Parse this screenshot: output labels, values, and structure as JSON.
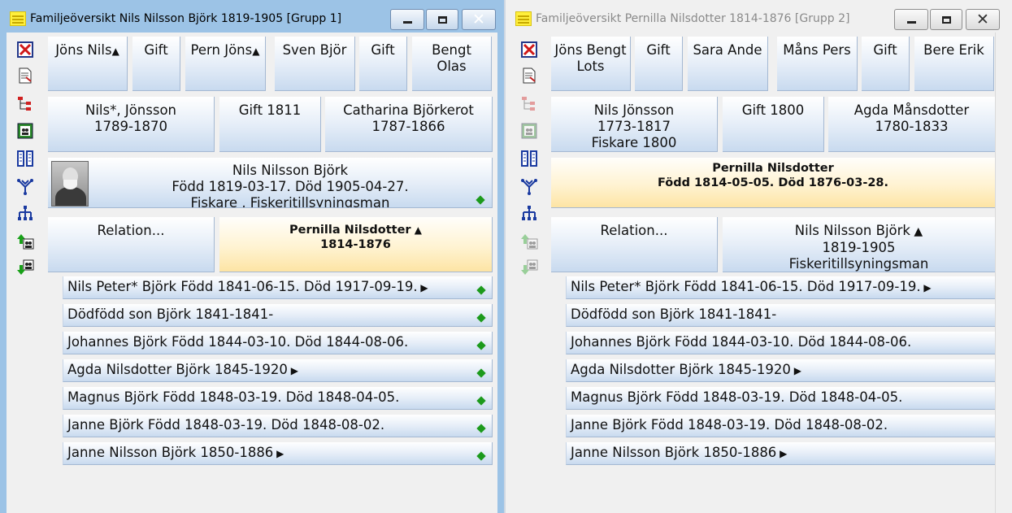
{
  "w1": {
    "title": "Familjeöversikt Nils Nilsson Björk 1819-1905 [Grupp 1]",
    "row1": [
      "Jöns Nils",
      "Gift",
      "Pern Jöns",
      "Sven Björ",
      "Gift",
      "Bengt Olas"
    ],
    "father": [
      "Nils*, Jönsson",
      "1789-1870"
    ],
    "parents_marriage": [
      "Gift 1811"
    ],
    "mother": [
      "Catharina Björkerot",
      "1787-1866"
    ],
    "main": [
      "Nils Nilsson Björk",
      "Född 1819-03-17. Död 1905-04-27.",
      "Fiskare , Fiskeritillsyningsman"
    ],
    "relation": [
      "Relation..."
    ],
    "spouse": [
      "Pernilla Nilsdotter",
      "1814-1876"
    ],
    "children": [
      "Nils Peter* Björk Född 1841-06-15. Död 1917-09-19.",
      "Dödfödd son Björk 1841-1841-",
      "Johannes Björk Född 1844-03-10. Död 1844-08-06.",
      "Agda Nilsdotter Björk 1845-1920",
      "Magnus Björk Född 1848-03-19. Död 1848-04-05.",
      "Janne Björk Född 1848-03-19. Död 1848-08-02.",
      "Janne Nilsson Björk 1850-1886"
    ]
  },
  "w2": {
    "title": "Familjeöversikt Pernilla Nilsdotter 1814-1876 [Grupp 2]",
    "row1": [
      "Jöns Bengt Lots",
      "Gift",
      "Sara Ande",
      "Måns Pers",
      "Gift",
      "Bere Erik"
    ],
    "father": [
      "Nils Jönsson",
      "1773-1817",
      "Fiskare  1800"
    ],
    "parents_marriage": [
      "Gift 1800"
    ],
    "mother": [
      "Agda Månsdotter",
      "1780-1833"
    ],
    "main": [
      "Pernilla Nilsdotter",
      "Född 1814-05-05. Död 1876-03-28."
    ],
    "relation": [
      "Relation..."
    ],
    "spouse": [
      "Nils Nilsson Björk",
      "1819-1905",
      "Fiskeritillsyningsman"
    ],
    "children": [
      "Nils Peter* Björk Född 1841-06-15. Död 1917-09-19.",
      "Dödfödd son Björk 1841-1841-",
      "Johannes Björk Född 1844-03-10. Död 1844-08-06.",
      "Agda Nilsdotter Björk 1845-1920",
      "Magnus Björk Född 1848-03-19. Död 1848-04-05.",
      "Janne Björk Född 1848-03-19. Död 1848-08-02.",
      "Janne Nilsson Björk 1850-1886"
    ]
  },
  "sidebar_icons": [
    "delete-icon",
    "report-icon",
    "tree-icon",
    "family-group-icon",
    "columns-icon",
    "ancestor-fan-icon",
    "descendant-tree-icon",
    "move-up-icon",
    "move-down-icon"
  ],
  "colors": {
    "accent_active": "#9cc3e6",
    "cell_gradient_bottom": "#c8daef",
    "selected_gradient_bottom": "#fde4a4",
    "marker_green": "#1c9a1c"
  }
}
